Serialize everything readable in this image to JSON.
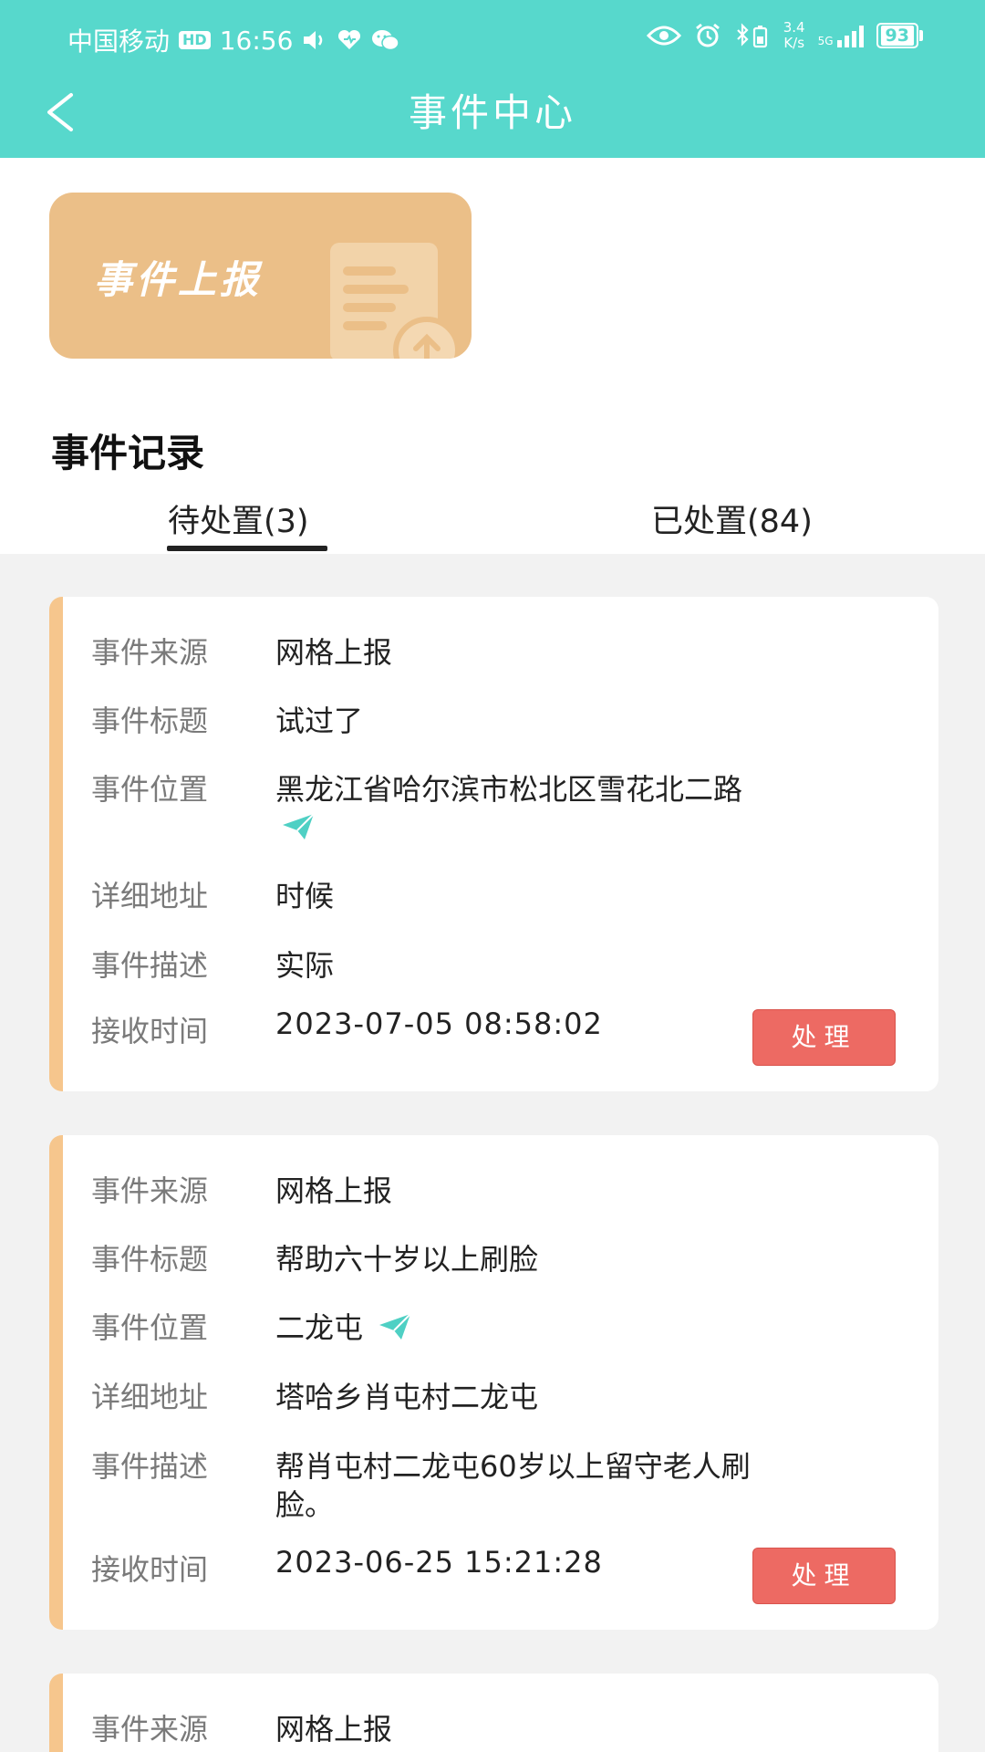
{
  "status_bar": {
    "carrier": "中国移动",
    "hd": "HD",
    "time": "16:56",
    "net_speed_top": "3.4",
    "net_speed_bottom": "K/s",
    "signal_label": "5G",
    "battery": "93"
  },
  "header": {
    "title": "事件中心"
  },
  "banner": {
    "label": "事件上报"
  },
  "section": {
    "title": "事件记录"
  },
  "tabs": [
    {
      "label": "待处置(3)",
      "active": true
    },
    {
      "label": "已处置(84)",
      "active": false
    }
  ],
  "field_labels": {
    "source": "事件来源",
    "title": "事件标题",
    "location": "事件位置",
    "address": "详细地址",
    "description": "事件描述",
    "received": "接收时间"
  },
  "events": [
    {
      "source": "网格上报",
      "title": "试过了",
      "location": "黑龙江省哈尔滨市松北区雪花北二路",
      "address": "时候",
      "description": "实际",
      "received": "2023-07-05 08:58:02",
      "action": "处理"
    },
    {
      "source": "网格上报",
      "title": "帮助六十岁以上刷脸",
      "location": "二龙屯",
      "address": "塔哈乡肖屯村二龙屯",
      "description": "帮肖屯村二龙屯60岁以上留守老人刷脸。",
      "received": "2023-06-25 15:21:28",
      "action": "处理"
    },
    {
      "source": "网格上报"
    }
  ],
  "colors": {
    "header_bg": "#57d8cc",
    "banner_bg": "#ebbf88",
    "card_accent": "#f6c68d",
    "action_button": "#ed6a63",
    "nav_icon": "#4fd0c4"
  }
}
